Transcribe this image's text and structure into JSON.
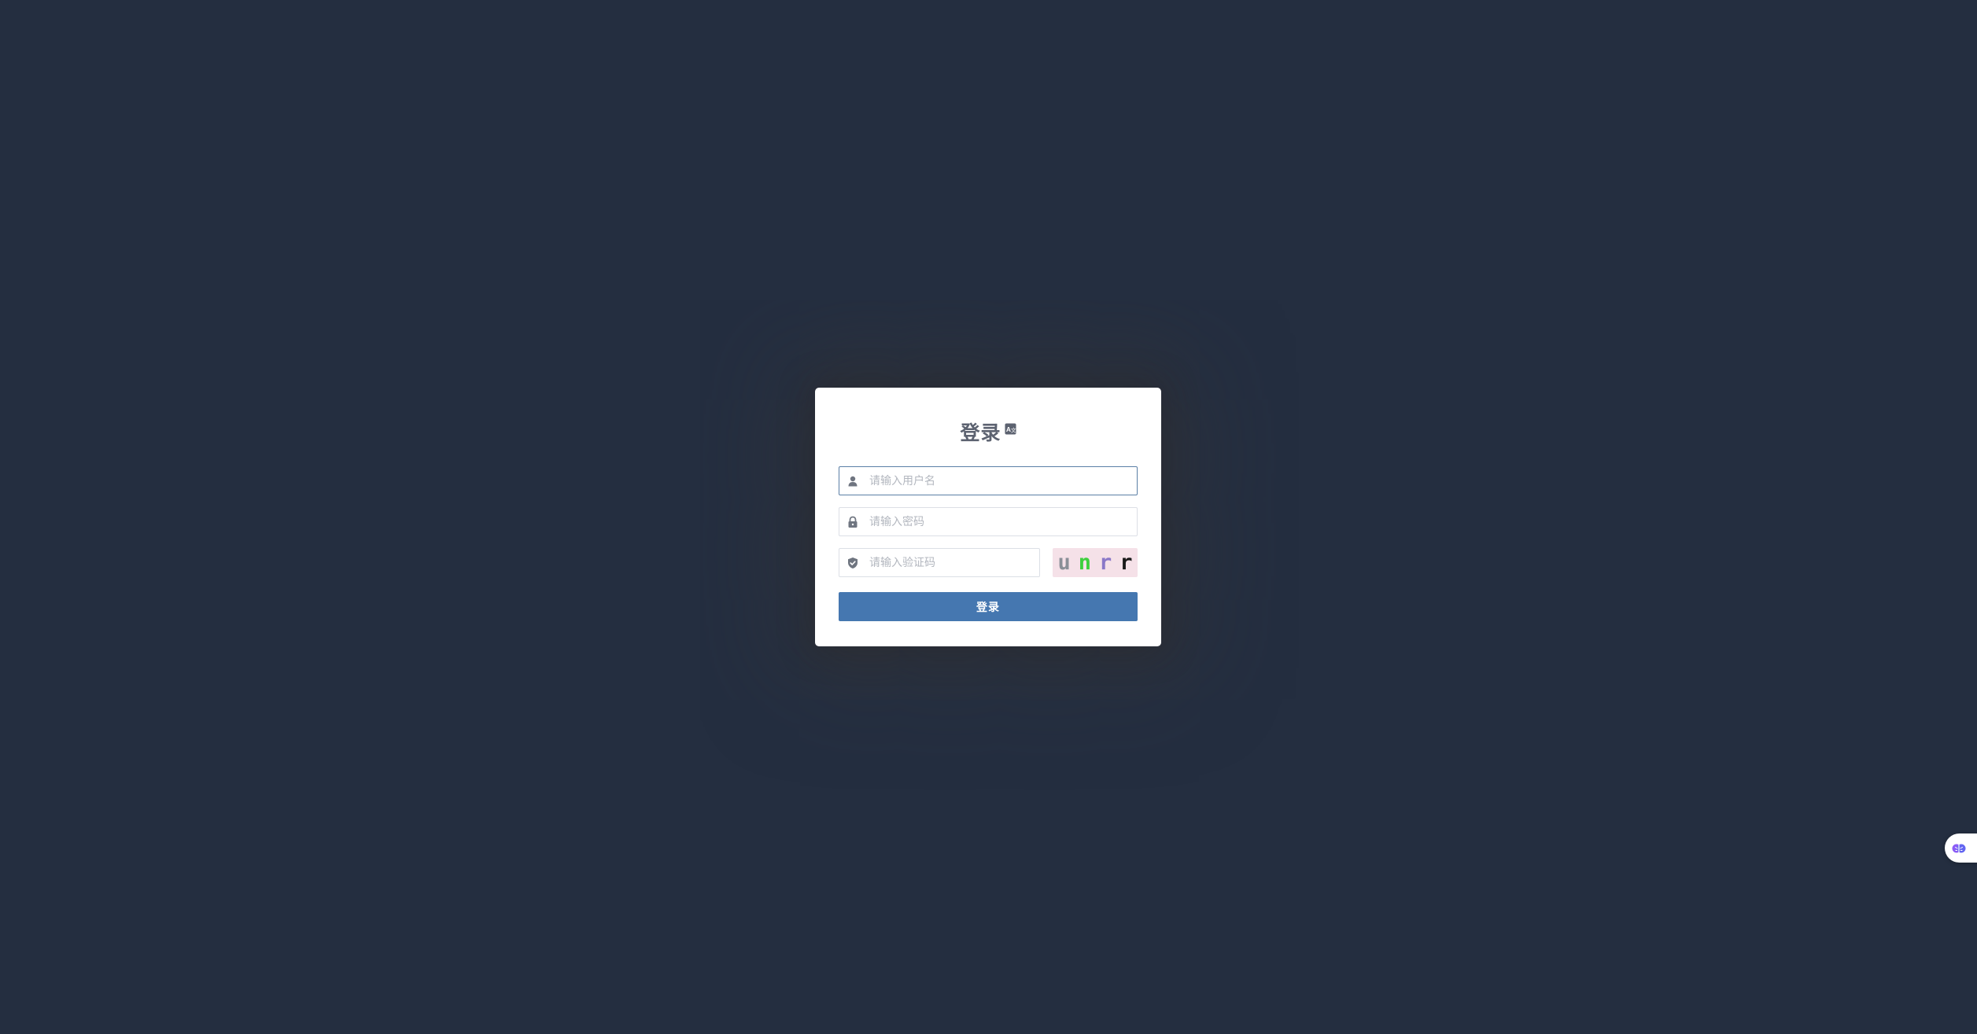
{
  "login": {
    "title": "登录",
    "title_icon": "translate-icon",
    "username": {
      "icon": "user-icon",
      "placeholder": "请输入用户名",
      "value": ""
    },
    "password": {
      "icon": "lock-icon",
      "placeholder": "请输入密码",
      "value": ""
    },
    "captcha": {
      "icon": "shield-check-icon",
      "placeholder": "请输入验证码",
      "value": "",
      "image_chars": [
        {
          "char": "u",
          "color": "#8a8f97"
        },
        {
          "char": "n",
          "color": "#3ecf3e"
        },
        {
          "char": "r",
          "color": "#8a78c8"
        },
        {
          "char": "r",
          "color": "#1a1a1a"
        }
      ]
    },
    "submit_label": "登录"
  },
  "floating_widget": {
    "icon": "brain-icon"
  },
  "colors": {
    "background": "#242e40",
    "primary": "#4577b0",
    "card": "#ffffff"
  }
}
